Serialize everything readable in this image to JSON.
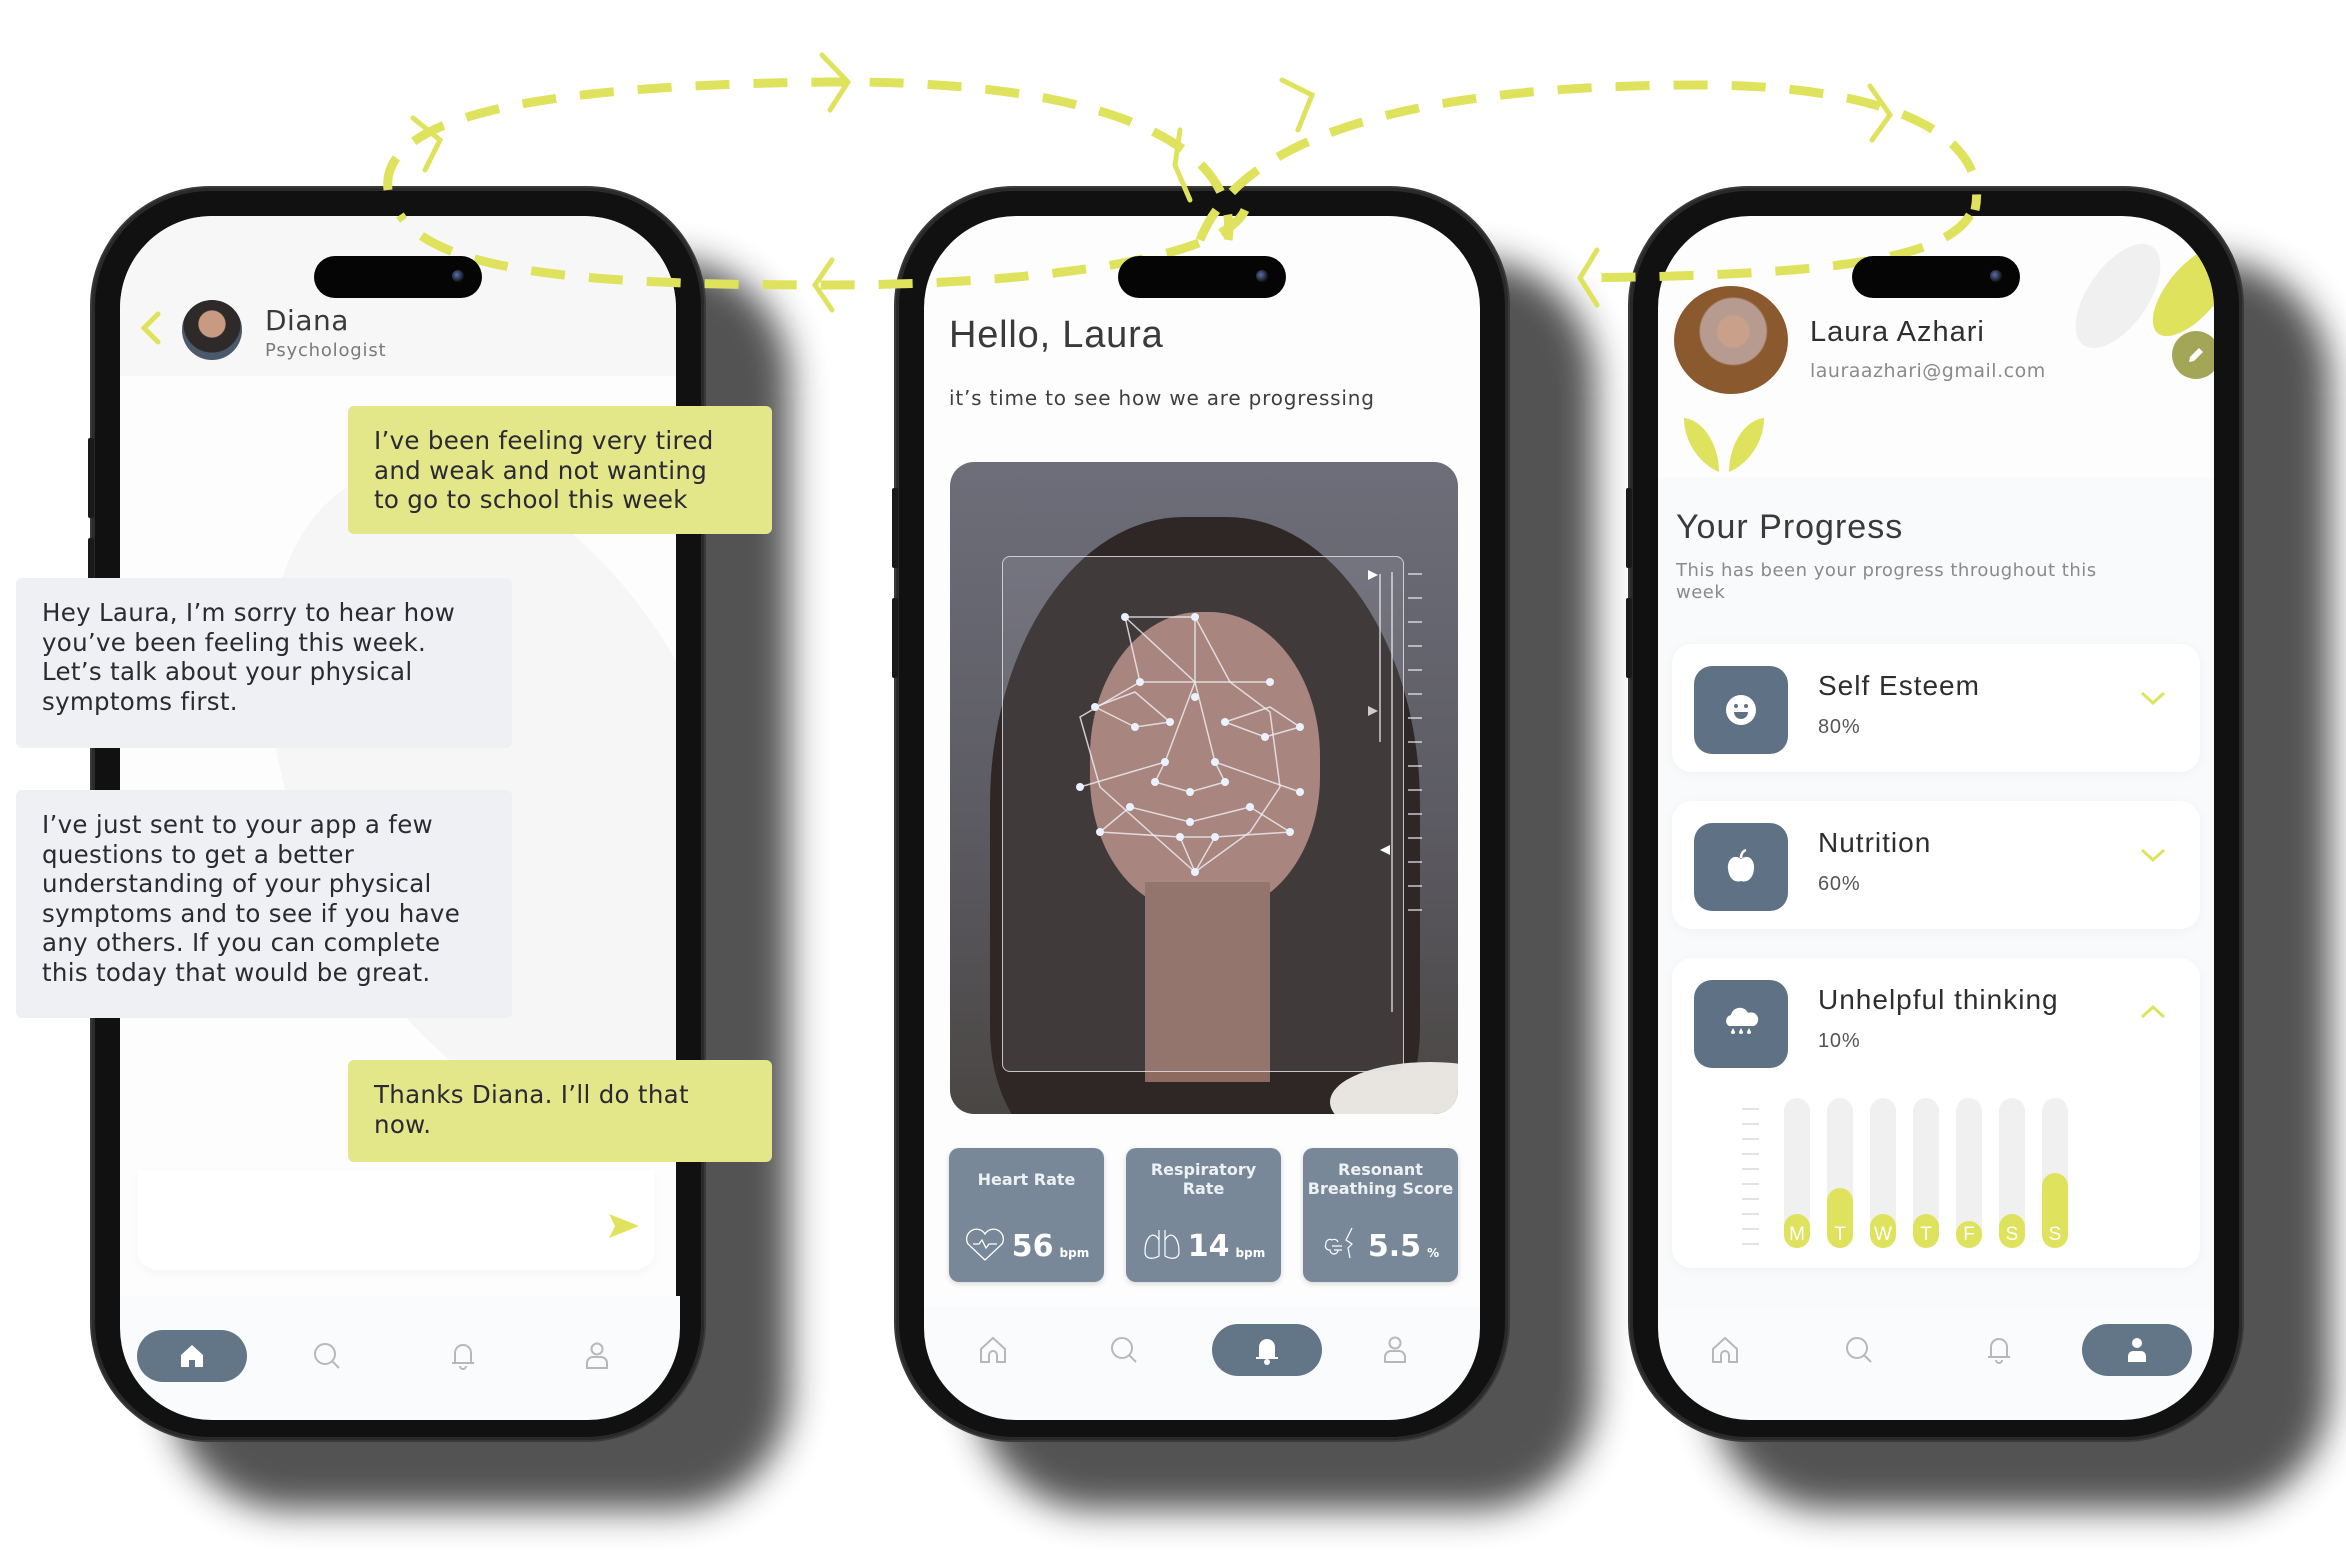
{
  "colors": {
    "accent": "#dfe25c",
    "slate": "#627688",
    "bubble_me": "#e4e68a",
    "bubble_them": "#eff0f4",
    "metric_card": "#788898"
  },
  "flow_arrows": {
    "style": "dashed",
    "color": "#dfe25c",
    "description": "navigation flow between screens"
  },
  "chat_screen": {
    "back_icon": "chevron-left-icon",
    "contact": {
      "name": "Diana",
      "role": "Psychologist",
      "avatar": "avatar-diana"
    },
    "messages": [
      {
        "from": "me",
        "lines": [
          "I’ve been feeling very tired",
          "and weak and not wanting",
          "to go to school this week"
        ]
      },
      {
        "from": "them",
        "lines": [
          "Hey Laura, I’m sorry to hear how",
          "you’ve been feeling this week.",
          "Let’s talk about your physical",
          "symptoms first."
        ]
      },
      {
        "from": "them",
        "lines": [
          "I’ve just sent to your app a few",
          "questions to get a better",
          "understanding of your physical",
          "symptoms and to see if you have",
          "any others. If you can complete",
          "this today that would be great."
        ]
      },
      {
        "from": "me",
        "lines": [
          "Thanks Diana. I’ll do that",
          "now."
        ]
      }
    ],
    "input": {
      "value": "",
      "placeholder": "",
      "send_icon": "send-icon"
    },
    "nav": {
      "items": [
        "home",
        "search",
        "notifications",
        "profile"
      ],
      "active": "home"
    }
  },
  "scan_screen": {
    "greeting": "Hello, Laura",
    "subtitle": "it’s time to see how we are progressing",
    "scan_image": "face-scan-photo",
    "metrics": [
      {
        "label_lines": [
          "Heart Rate"
        ],
        "value": "56",
        "unit": "bpm",
        "icon": "heart-pulse-icon"
      },
      {
        "label_lines": [
          "Respiratory",
          "Rate"
        ],
        "value": "14",
        "unit": "bpm",
        "icon": "lungs-icon"
      },
      {
        "label_lines": [
          "Resonant",
          "Breathing Score"
        ],
        "value": "5.5",
        "unit": "%",
        "icon": "breath-icon"
      }
    ],
    "nav": {
      "items": [
        "home",
        "search",
        "notifications",
        "profile"
      ],
      "active": "notifications"
    }
  },
  "profile_screen": {
    "user": {
      "name": "Laura Azhari",
      "email": "lauraazhari@gmail.com",
      "avatar": "avatar-laura"
    },
    "edit_icon": "pencil-icon",
    "section_title": "Your Progress",
    "section_subtitle_lines": [
      "This has been your progress throughout this",
      "week"
    ],
    "items": [
      {
        "title": "Self Esteem",
        "percent": "80%",
        "icon": "smiley-icon",
        "expanded": false
      },
      {
        "title": "Nutrition",
        "percent": "60%",
        "icon": "apple-icon",
        "expanded": false
      },
      {
        "title": "Unhelpful thinking",
        "percent": "10%",
        "icon": "rain-cloud-icon",
        "expanded": true
      }
    ],
    "weekly_chart": {
      "days": [
        "M",
        "T",
        "W",
        "T",
        "F",
        "S",
        "S"
      ],
      "values": [
        0.23,
        0.4,
        0.23,
        0.23,
        0.18,
        0.23,
        0.5
      ]
    },
    "nav": {
      "items": [
        "home",
        "search",
        "notifications",
        "profile"
      ],
      "active": "profile"
    }
  }
}
